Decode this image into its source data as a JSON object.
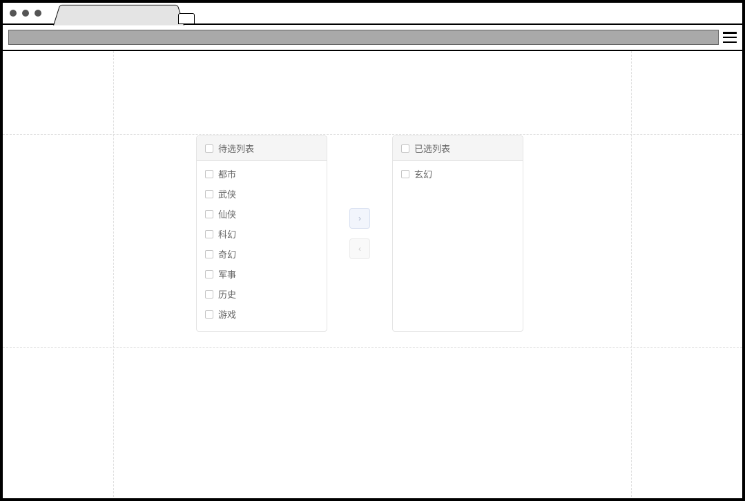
{
  "transfer": {
    "source_title": "待选列表",
    "target_title": "已选列表",
    "source_items": [
      {
        "label": "都市"
      },
      {
        "label": "武侠"
      },
      {
        "label": "仙侠"
      },
      {
        "label": "科幻"
      },
      {
        "label": "奇幻"
      },
      {
        "label": "军事"
      },
      {
        "label": "历史"
      },
      {
        "label": "游戏"
      }
    ],
    "target_items": [
      {
        "label": "玄幻"
      }
    ],
    "move_right_label": "›",
    "move_left_label": "‹"
  }
}
